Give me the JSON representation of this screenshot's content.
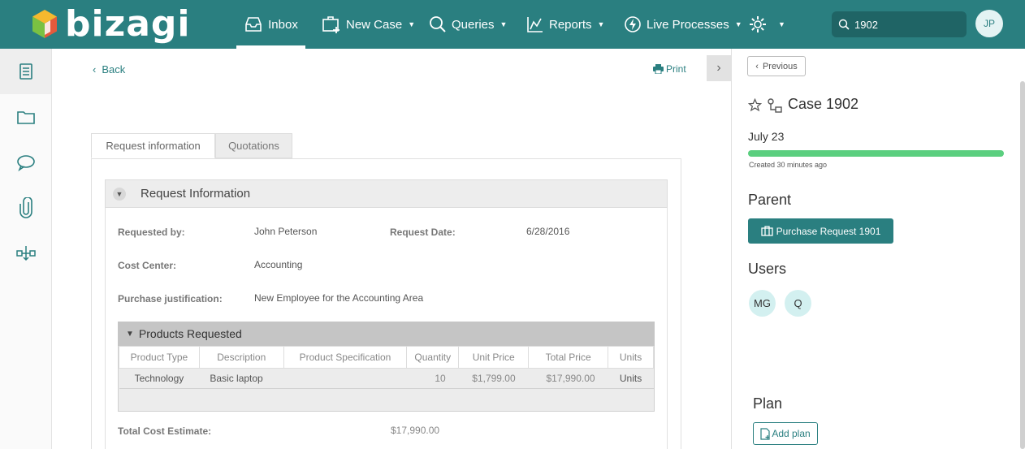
{
  "brand": {
    "name": "bizagi"
  },
  "nav": {
    "inbox": "Inbox",
    "new_case": "New Case",
    "queries": "Queries",
    "reports": "Reports",
    "live_processes": "Live Processes"
  },
  "search": {
    "value": "1902"
  },
  "user": {
    "initials": "JP"
  },
  "rail": [
    "work-portal",
    "folders",
    "comments",
    "attachments",
    "process-map"
  ],
  "main": {
    "back_label": "Back",
    "print_label": "Print",
    "tabs": [
      "Request information",
      "Quotations"
    ],
    "group_title": "Request Information",
    "fields": {
      "requested_by_label": "Requested by:",
      "requested_by_value": "John Peterson",
      "request_date_label": "Request Date:",
      "request_date_value": "6/28/2016",
      "cost_center_label": "Cost Center:",
      "cost_center_value": "Accounting",
      "justification_label": "Purchase justification:",
      "justification_value": "New Employee for the Accounting Area",
      "total_cost_label": "Total Cost Estimate:",
      "total_cost_value": "$17,990.00"
    },
    "products": {
      "title": "Products Requested",
      "columns": [
        "Product Type",
        "Description",
        "Product Specification",
        "Quantity",
        "Unit Price",
        "Total Price",
        "Units"
      ],
      "rows": [
        [
          "Technology",
          "Basic laptop",
          "",
          "10",
          "$1,799.00",
          "$17,990.00",
          "Units"
        ]
      ]
    }
  },
  "case": {
    "previous_label": "Previous",
    "title": "Case 1902",
    "date": "July 23",
    "progress": 1.0,
    "created": "Created 30 minutes ago",
    "parent_heading": "Parent",
    "parent_button": "Purchase Request 1901",
    "users_heading": "Users",
    "users": [
      "MG",
      "Q"
    ],
    "plan_heading": "Plan",
    "add_plan": "Add plan"
  },
  "colors": {
    "brand": "#2a7f80",
    "progress": "#5bcf7f"
  }
}
